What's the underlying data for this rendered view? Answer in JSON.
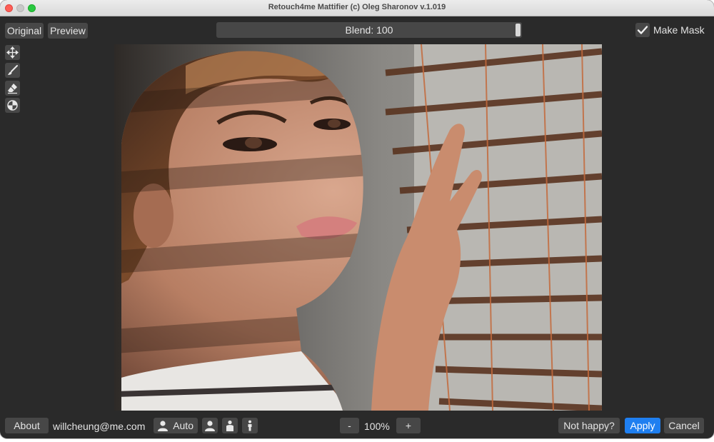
{
  "window": {
    "title": "Retouch4me Mattifier (c) Oleg Sharonov v.1.019"
  },
  "toolbar": {
    "original_label": "Original",
    "preview_label": "Preview",
    "blend_label": "Blend: 100",
    "blend_value": 100,
    "make_mask_label": "Make Mask",
    "make_mask_checked": true
  },
  "tools": [
    {
      "icon": "move-icon"
    },
    {
      "icon": "brush-icon"
    },
    {
      "icon": "eraser-icon"
    },
    {
      "icon": "fill-icon"
    }
  ],
  "bottom": {
    "about_label": "About",
    "email": "willcheung@me.com",
    "auto_label": "Auto",
    "zoom_out_label": "-",
    "zoom_level": "100%",
    "zoom_in_label": "+",
    "not_happy_label": "Not happy?",
    "apply_label": "Apply",
    "cancel_label": "Cancel"
  },
  "colors": {
    "background": "#2a2a2a",
    "button": "#474747",
    "accent": "#1f7ff0"
  }
}
